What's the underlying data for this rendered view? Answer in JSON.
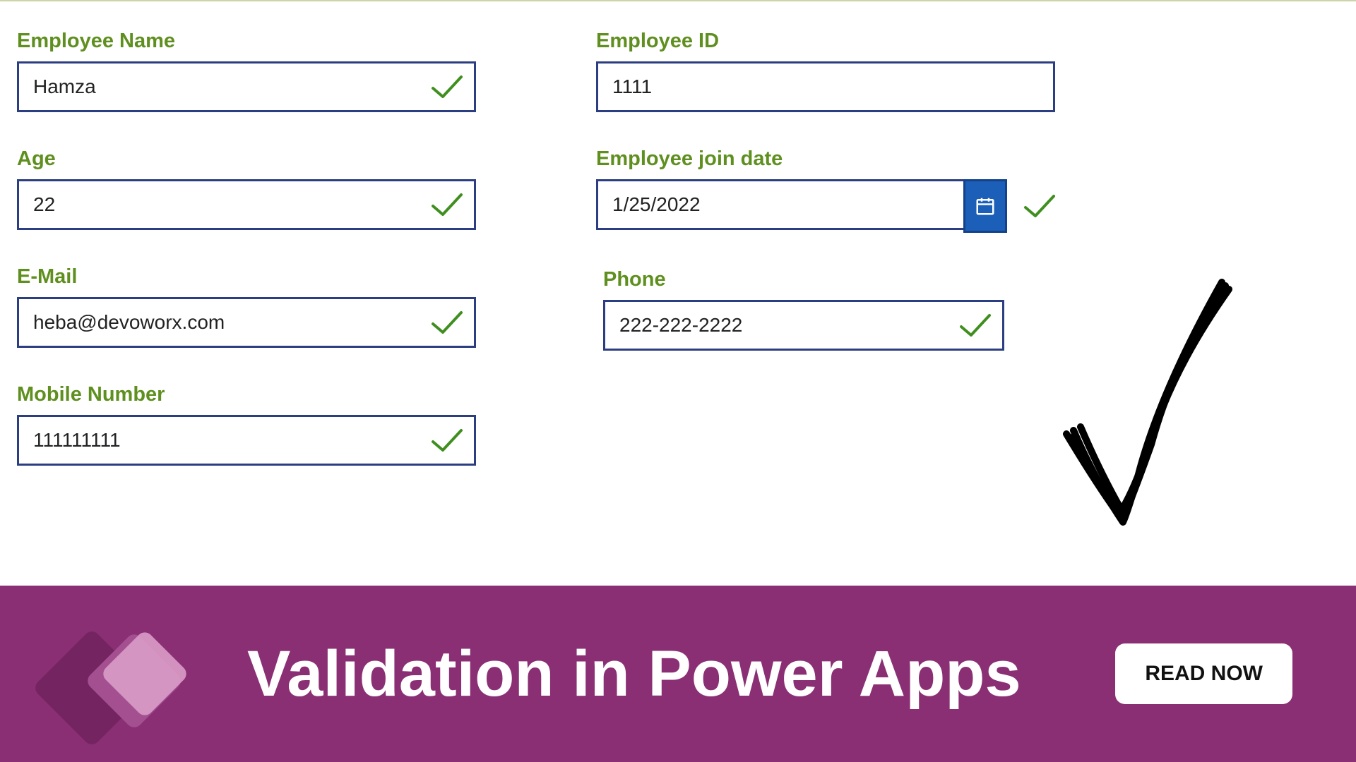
{
  "form": {
    "left": [
      {
        "label": "Employee Name",
        "value": "Hamza",
        "valid": true
      },
      {
        "label": "Age",
        "value": "22",
        "valid": true
      },
      {
        "label": "E-Mail",
        "value": "heba@devoworx.com",
        "valid": true
      },
      {
        "label": "Mobile Number",
        "value": "111111111",
        "valid": true
      }
    ],
    "right": [
      {
        "label": "Employee  ID",
        "value": "1111",
        "valid": false,
        "type": "text"
      },
      {
        "label": "Employee join date",
        "value": "1/25/2022",
        "valid": true,
        "type": "date"
      },
      {
        "label": "Phone",
        "value": "222-222-2222",
        "valid": true,
        "type": "text",
        "narrow": true
      }
    ]
  },
  "banner": {
    "title": "Validation in Power Apps",
    "button": "READ NOW"
  }
}
